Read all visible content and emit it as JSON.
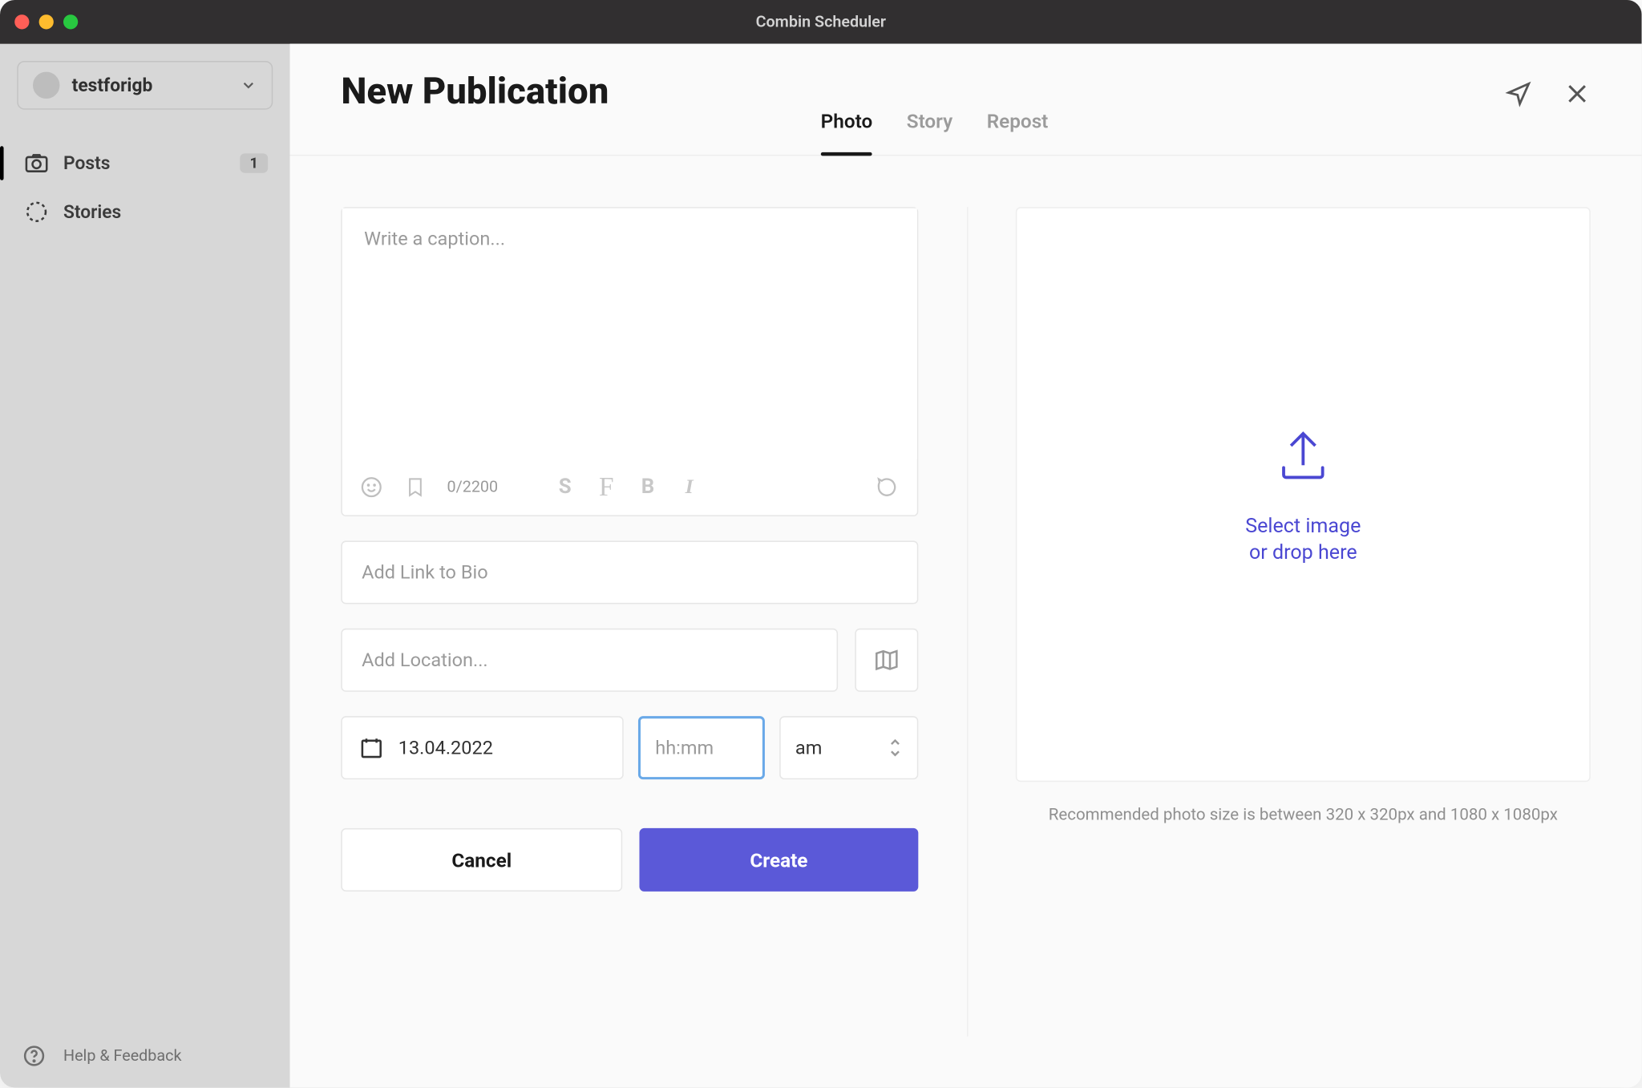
{
  "titlebar": {
    "title": "Combin Scheduler"
  },
  "sidebar": {
    "account_name": "testforigb",
    "nav": [
      {
        "label": "Posts",
        "badge": "1"
      },
      {
        "label": "Stories"
      }
    ],
    "help_label": "Help & Feedback"
  },
  "header": {
    "title": "New Publication",
    "tabs": [
      "Photo",
      "Story",
      "Repost"
    ]
  },
  "caption": {
    "placeholder": "Write a caption...",
    "counter": "0/2200"
  },
  "link_bio": {
    "placeholder": "Add Link to Bio"
  },
  "location": {
    "placeholder": "Add Location..."
  },
  "schedule": {
    "date": "13.04.2022",
    "time_placeholder": "hh:mm",
    "ampm": "am"
  },
  "buttons": {
    "cancel": "Cancel",
    "create": "Create"
  },
  "upload": {
    "line1": "Select image",
    "line2": "or drop here",
    "hint": "Recommended photo size is between 320 x 320px and 1080 x 1080px"
  }
}
